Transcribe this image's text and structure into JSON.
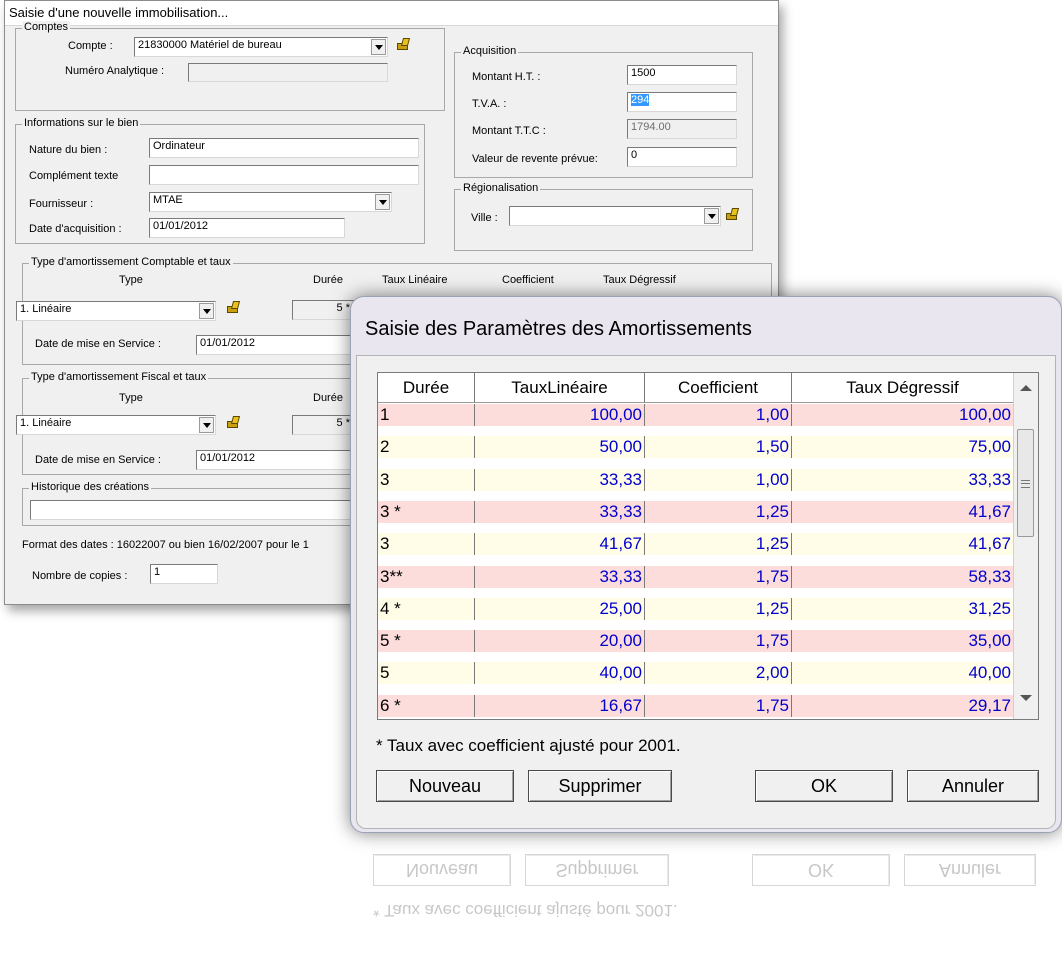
{
  "main_window": {
    "title": "Saisie d'une nouvelle immobilisation...",
    "comptes": {
      "group_label": "Comptes",
      "compte_label": "Compte :",
      "compte_value": "21830000    Matériel de bureau",
      "analytique_label": "Numéro Analytique :",
      "analytique_value": ""
    },
    "acquisition": {
      "group_label": "Acquisition",
      "montant_ht_label": "Montant H.T. :",
      "montant_ht_value": "1500",
      "tva_label": "T.V.A. :",
      "tva_value": "294",
      "montant_ttc_label": "Montant T.T.C :",
      "montant_ttc_value": "1794.00",
      "revente_label": "Valeur de revente prévue:",
      "revente_value": "0"
    },
    "informations": {
      "group_label": "Informations sur le bien",
      "nature_label": "Nature du bien :",
      "nature_value": "Ordinateur",
      "complement_label": "Complément texte",
      "complement_value": "",
      "fournisseur_label": "Fournisseur :",
      "fournisseur_value": "MTAE",
      "date_label": "Date d'acquisition :",
      "date_value": "01/01/2012"
    },
    "regionalisation": {
      "group_label": "Régionalisation",
      "ville_label": "Ville :",
      "ville_value": ""
    },
    "amort_comptable": {
      "group_label": "Type d'amortissement Comptable et taux",
      "col_type": "Type",
      "col_duree": "Durée",
      "col_taux_lineaire": "Taux Linéaire",
      "col_coefficient": "Coefficient",
      "col_taux_degressif": "Taux Dégressif",
      "type_value": "1. Linéaire",
      "duree_value": "5 *",
      "mise_service_label": "Date de mise en Service :",
      "mise_service_value": "01/01/2012"
    },
    "amort_fiscal": {
      "group_label": "Type d'amortissement Fiscal et taux",
      "col_type": "Type",
      "col_duree": "Durée",
      "type_value": "1. Linéaire",
      "duree_value": "5 *",
      "mise_service_label": "Date de mise en Service :",
      "mise_service_value": "01/01/2012"
    },
    "historique": {
      "group_label": "Historique des créations",
      "value": ""
    },
    "format_note": "Format des dates : 16022007 ou bien 16/02/2007 pour le 1",
    "copies_label": "Nombre de copies :",
    "copies_value": "1"
  },
  "params_dialog": {
    "title": "Saisie des Paramètres des Amortissements",
    "columns": [
      "Durée",
      "TauxLinéaire",
      "Coefficient",
      "Taux Dégressif"
    ],
    "rows": [
      {
        "duree": "1",
        "taux_lineaire": "100,00",
        "coefficient": "1,00",
        "taux_degressif": "100,00",
        "bg": "#fddcdc"
      },
      {
        "duree": "2",
        "taux_lineaire": "50,00",
        "coefficient": "1,50",
        "taux_degressif": "75,00",
        "bg": "#fffde8"
      },
      {
        "duree": "3",
        "taux_lineaire": "33,33",
        "coefficient": "1,00",
        "taux_degressif": "33,33",
        "bg": "#fffde8"
      },
      {
        "duree": "3 *",
        "taux_lineaire": "33,33",
        "coefficient": "1,25",
        "taux_degressif": "41,67",
        "bg": "#fddcdc"
      },
      {
        "duree": "3",
        "taux_lineaire": "41,67",
        "coefficient": "1,25",
        "taux_degressif": "41,67",
        "bg": "#fffde8"
      },
      {
        "duree": "3**",
        "taux_lineaire": "33,33",
        "coefficient": "1,75",
        "taux_degressif": "58,33",
        "bg": "#fddcdc"
      },
      {
        "duree": "4 *",
        "taux_lineaire": "25,00",
        "coefficient": "1,25",
        "taux_degressif": "31,25",
        "bg": "#fffde8"
      },
      {
        "duree": "5 *",
        "taux_lineaire": "20,00",
        "coefficient": "1,75",
        "taux_degressif": "35,00",
        "bg": "#fddcdc"
      },
      {
        "duree": "5",
        "taux_lineaire": "40,00",
        "coefficient": "2,00",
        "taux_degressif": "40,00",
        "bg": "#fffde8"
      },
      {
        "duree": "6 *",
        "taux_lineaire": "16,67",
        "coefficient": "1,75",
        "taux_degressif": "29,17",
        "bg": "#fddcdc"
      }
    ],
    "footnote": "* Taux avec coefficient ajusté pour 2001.",
    "buttons": {
      "nouveau": "Nouveau",
      "supprimer": "Supprimer",
      "ok": "OK",
      "annuler": "Annuler"
    }
  }
}
